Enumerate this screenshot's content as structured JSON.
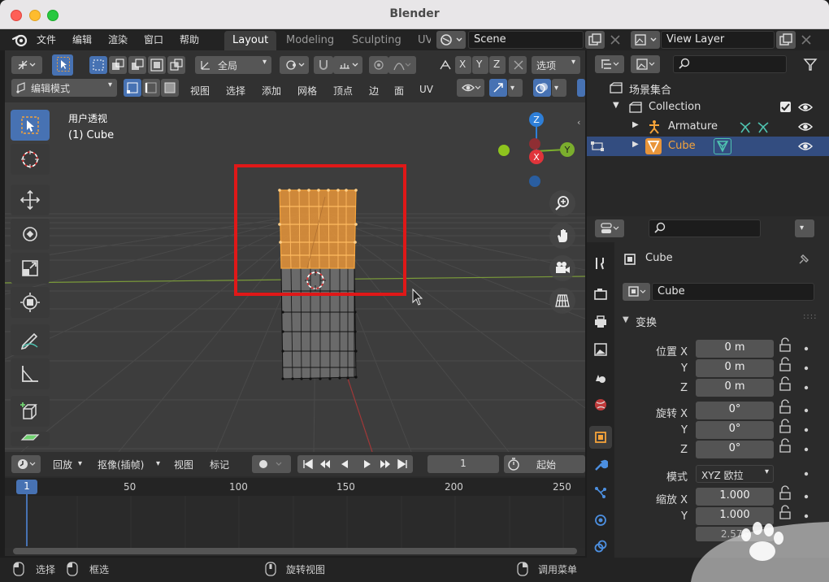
{
  "window": {
    "title": "Blender"
  },
  "menu": {
    "items": [
      "文件",
      "编辑",
      "渲染",
      "窗口",
      "帮助"
    ],
    "workspaces": [
      "Layout",
      "Modeling",
      "Sculpting",
      "UV"
    ],
    "scene": "Scene",
    "view_layer": "View Layer"
  },
  "viewport": {
    "transform_space": "全局",
    "options_label": "选项",
    "axis_x": "X",
    "axis_y": "Y",
    "axis_z": "Z",
    "mode": "编辑模式",
    "header_menu": [
      "视图",
      "选择",
      "添加",
      "网格",
      "顶点",
      "边",
      "面",
      "UV"
    ],
    "info_line1": "用户透视",
    "info_line2": "(1) Cube",
    "gizmo": {
      "z": "Z",
      "y": "Y",
      "x": "X"
    },
    "highlight_color": "#e01818",
    "selection_color": "#f5a33a"
  },
  "timeline": {
    "playback": "回放",
    "keying": "抠像(插帧)",
    "view": "视图",
    "marker": "标记",
    "current_frame": "1",
    "start_label": "起始",
    "ruler": [
      "50",
      "100",
      "150",
      "200",
      "250"
    ],
    "playhead": "1"
  },
  "status": {
    "left": "选择",
    "middle_left": "框选",
    "middle": "旋转视图",
    "right": "调用菜单"
  },
  "outliner": {
    "root": "场景集合",
    "collection": "Collection",
    "armature": "Armature",
    "cube": "Cube"
  },
  "properties": {
    "object_name": "Cube",
    "datablock": "Cube",
    "section": "变换",
    "location_label": "位置 X",
    "rotation_label": "旋转 X",
    "scale_label": "缩放 X",
    "y_label": "Y",
    "z_label": "Z",
    "mode_label": "模式",
    "location": [
      "0 m",
      "0 m",
      "0 m"
    ],
    "rotation": [
      "0°",
      "0°",
      "0°"
    ],
    "rotation_mode": "XYZ 欧拉",
    "scale": [
      "1.000",
      "1.000",
      "2.576"
    ]
  },
  "colors": {
    "accent": "#4772b3",
    "outliner_selected": "#334d80",
    "gizmo_x": "#e0343a",
    "gizmo_y": "#7bae2d",
    "gizmo_z": "#2e7fd8"
  }
}
